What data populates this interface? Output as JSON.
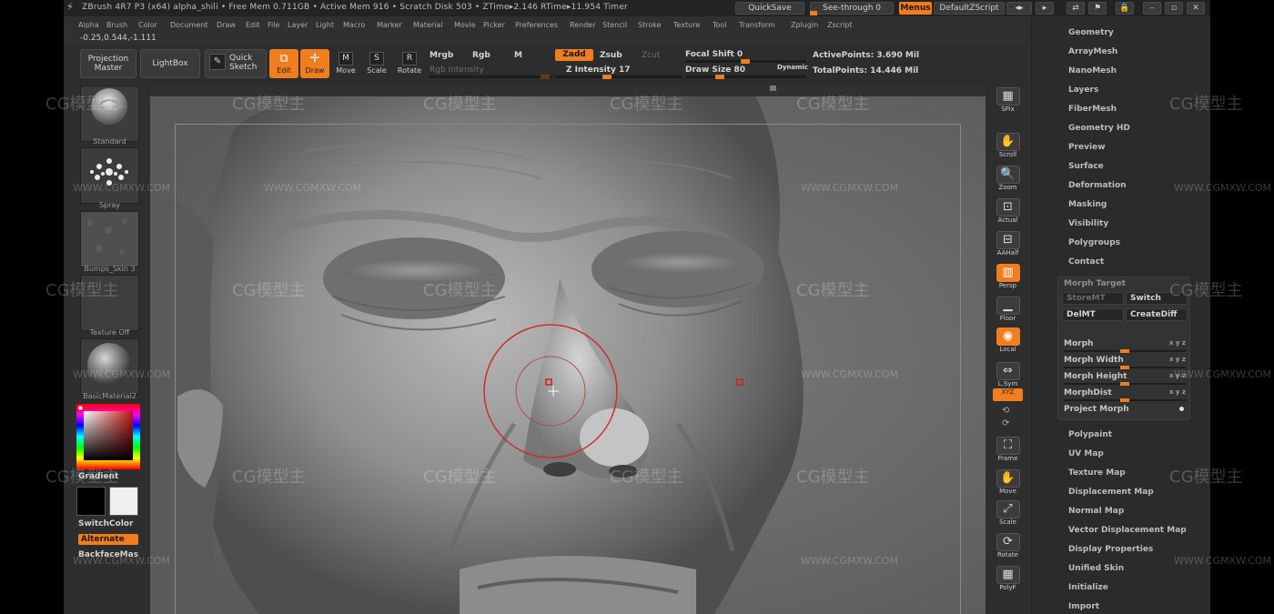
{
  "titlebar": {
    "title": "ZBrush 4R7 P3 (x64)   alpha_shili   • Free Mem 0.711GB • Active Mem 916 • Scratch Disk 503 • ZTime▸2.146 RTime▸11.954 Timer",
    "quicksave": "QuickSave",
    "seethrough": "See-through  0",
    "menus": "Menus",
    "script": "DefaultZScript"
  },
  "menubar": [
    "Alpha",
    "Brush",
    "Color",
    "Document",
    "Draw",
    "Edit",
    "File",
    "Layer",
    "Light",
    "Macro",
    "Marker",
    "Material",
    "Movie",
    "Picker",
    "Preferences",
    "Render",
    "Stencil",
    "Stroke",
    "Texture",
    "Tool",
    "Transform",
    "Zplugin",
    "Zscript"
  ],
  "coords": "-0.25,0.544,-1.111",
  "toolbar": {
    "projection_master": "Projection Master",
    "lightbox": "LightBox",
    "quick_sketch": "Quick Sketch",
    "edit": "Edit",
    "draw": "Draw",
    "move": "Move",
    "scale": "Scale",
    "rotate": "Rotate",
    "move_key": "M",
    "scale_key": "S",
    "rotate_key": "R",
    "mrgb": "Mrgb",
    "rgb": "Rgb",
    "m": "M",
    "rgb_intensity": "Rgb Intensity",
    "zadd": "Zadd",
    "zsub": "Zsub",
    "zcut": "Zcut",
    "z_intensity": "Z Intensity 17",
    "focal_shift": "Focal Shift 0",
    "draw_size": "Draw Size 80",
    "dynamic": "Dynamic",
    "active_points": "ActivePoints: 3.690 Mil",
    "total_points": "TotalPoints: 14.446 Mil"
  },
  "leftshelf": {
    "brush": "Standard",
    "stroke": "Spray",
    "alpha": "Bumps_Skin 3",
    "texture": "Texture Off",
    "material": "BasicMaterial2",
    "gradient": "Gradient",
    "switchcolor": "SwitchColor",
    "alternate": "Alternate",
    "backface": "BackfaceMas"
  },
  "rightshelf": [
    {
      "label": "SPix",
      "icon": "spix-icon",
      "glyph": "▦"
    },
    {
      "label": "Scroll",
      "icon": "hand-icon",
      "glyph": "✋"
    },
    {
      "label": "Zoom",
      "icon": "zoom-icon",
      "glyph": "🔍"
    },
    {
      "label": "Actual",
      "icon": "actual-icon",
      "glyph": "⊡"
    },
    {
      "label": "AAHalf",
      "icon": "aahalf-icon",
      "glyph": "⊟"
    },
    {
      "label": "Persp",
      "icon": "persp-icon",
      "glyph": "▥"
    },
    {
      "label": "Floor",
      "icon": "floor-icon",
      "glyph": "▁"
    },
    {
      "label": "Local",
      "icon": "local-icon",
      "glyph": "◉"
    },
    {
      "label": "L.Sym",
      "icon": "lsym-icon",
      "glyph": "⇔"
    },
    {
      "label": "XYZ",
      "icon": "xyz-icon",
      "glyph": "xyz"
    },
    {
      "label": "Frame",
      "icon": "frame-icon",
      "glyph": "⛶"
    },
    {
      "label": "Move",
      "icon": "move-icon",
      "glyph": "✋"
    },
    {
      "label": "Scale",
      "icon": "scale-icon",
      "glyph": "⤢"
    },
    {
      "label": "Rotate",
      "icon": "rotate-icon",
      "glyph": "⟳"
    },
    {
      "label": "PolyF",
      "icon": "polyf-icon",
      "glyph": "▦"
    }
  ],
  "rightpanel": {
    "items_top": [
      "Geometry",
      "ArrayMesh",
      "NanoMesh",
      "Layers",
      "FiberMesh",
      "Geometry HD",
      "Preview",
      "Surface",
      "Deformation",
      "Masking",
      "Visibility",
      "Polygroups",
      "Contact"
    ],
    "morph_target": {
      "title": "Morph Target",
      "storemt": "StoreMT",
      "switch": "Switch",
      "delmt": "DelMT",
      "creatediff": "CreateDiff",
      "morph": "Morph",
      "morph_width": "Morph Width",
      "morph_height": "Morph Height",
      "morphdist": "MorphDist",
      "project_morph": "Project Morph",
      "xyz": "x y z"
    },
    "items_bottom": [
      "Polypaint",
      "UV Map",
      "Texture Map",
      "Displacement Map",
      "Normal Map",
      "Vector Displacement Map",
      "Display Properties",
      "Unified Skin",
      "Initialize",
      "Import"
    ]
  },
  "watermark": {
    "logo": "CG模型主",
    "url": "WWW.CGMXW.COM"
  },
  "colors": {
    "accent": "#f07d1e",
    "background": "#303030",
    "canvas": "#666666"
  }
}
